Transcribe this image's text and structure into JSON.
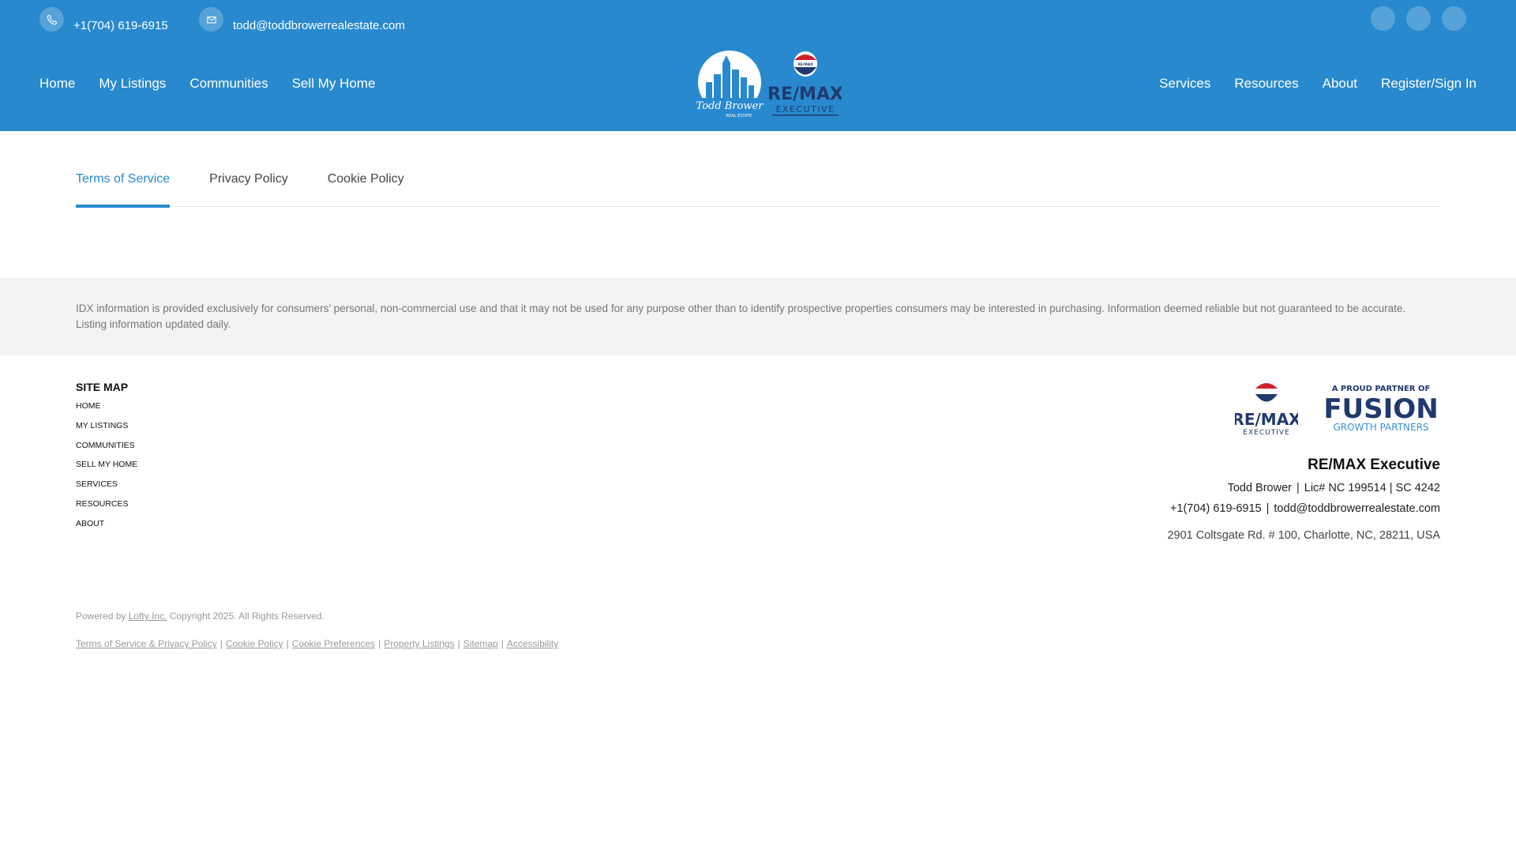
{
  "header": {
    "phone": "+1(704) 619-6915",
    "email": "todd@toddbrowerrealestate.com",
    "nav_left": [
      "Home",
      "My Listings",
      "Communities",
      "Sell My Home"
    ],
    "nav_right": [
      "Services",
      "Resources",
      "About"
    ],
    "signin": "Register/Sign In",
    "social_icons": [
      "facebook-icon",
      "instagram-icon",
      "linkedin-icon"
    ],
    "logo": {
      "script_name": "Todd Brower",
      "sub": "REAL ESTATE",
      "brand": "RE/MAX",
      "brand_sub": "EXECUTIVE",
      "balloon_text": "RE/MAX"
    }
  },
  "tabs": [
    {
      "label": "Terms of Service",
      "active": true
    },
    {
      "label": "Privacy Policy",
      "active": false
    },
    {
      "label": "Cookie Policy",
      "active": false
    }
  ],
  "disclaimer": "IDX information is provided exclusively for consumers’ personal, non-commercial use and that it may not be used for any purpose other than to identify prospective properties consumers may be interested in purchasing. Information deemed reliable but not guaranteed to be accurate. Listing information updated daily.",
  "sitemap": {
    "title": "SITE MAP",
    "items": [
      "HOME",
      "MY LISTINGS",
      "COMMUNITIES",
      "SELL MY HOME",
      "SERVICES",
      "RESOURCES",
      "ABOUT"
    ]
  },
  "footer_logos": {
    "remax": "RE/MAX",
    "remax_sub": "EXECUTIVE",
    "partner_top": "A PROUD PARTNER OF",
    "partner_main": "FUSION",
    "partner_sub": "GROWTH PARTNERS"
  },
  "office": {
    "name": "RE/MAX Executive",
    "agent": "Todd Brower",
    "license": "Lic# NC 199514 | SC 4242",
    "phone": "+1(704) 619-6915",
    "email": "todd@toddbrowerrealestate.com",
    "address": "2901 Coltsgate Rd. # 100, Charlotte, NC, 28211, USA",
    "sep": "|"
  },
  "powered": {
    "prefix": "Powered by",
    "company": "Lofty Inc.",
    "copyright": "Copyright 2025. All Rights Reserved."
  },
  "legal_links": [
    "Terms of Service & Privacy Policy",
    "Cookie Policy",
    "Cookie Preferences",
    "Property Listings",
    "Sitemap",
    "Accessibility"
  ],
  "colors": {
    "brand_blue": "#2889cf",
    "remax_navy": "#1f3a6e",
    "remax_red": "#d0202e",
    "fusion_blue": "#3d8fd1"
  }
}
